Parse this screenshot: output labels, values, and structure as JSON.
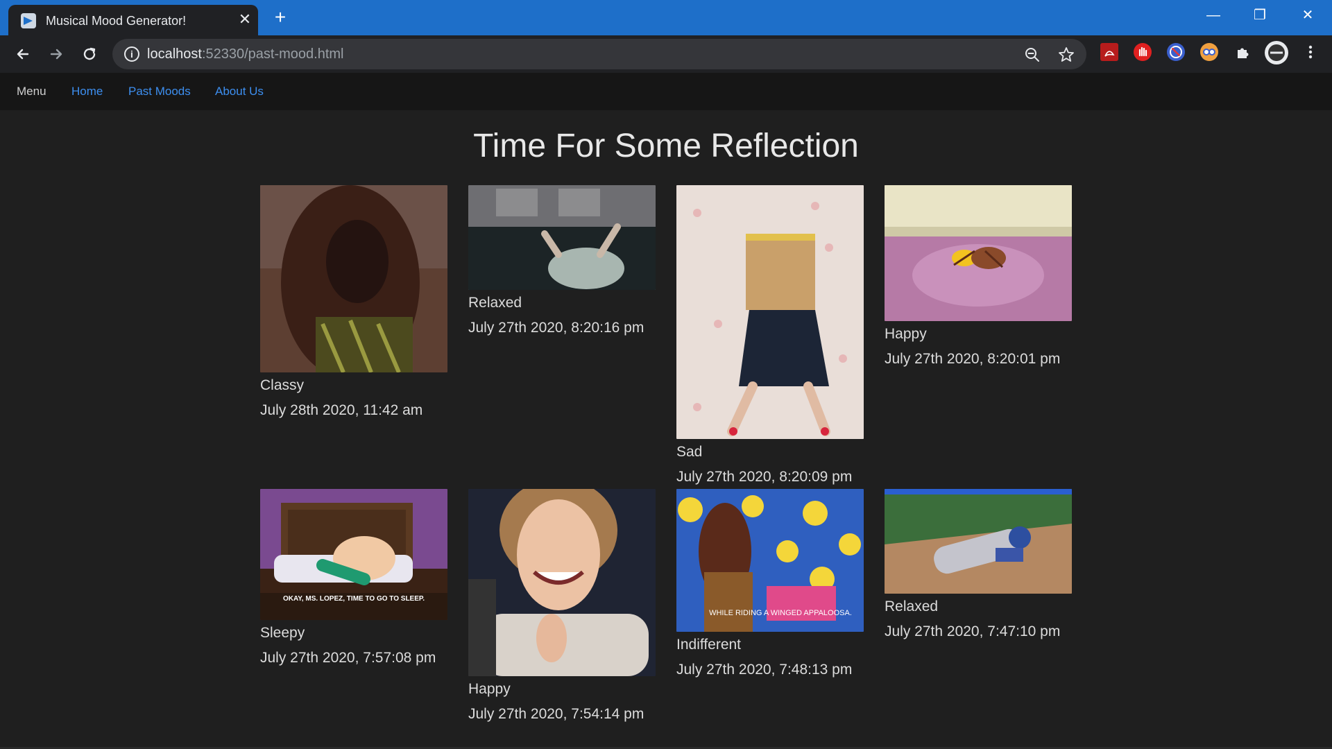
{
  "browser": {
    "tab_title": "Musical Mood Generator!",
    "tab_close": "✕",
    "new_tab": "+",
    "url_host": "localhost",
    "url_rest": ":52330/past-mood.html",
    "window_controls": {
      "minimize": "—",
      "restore": "❐",
      "close": "✕"
    },
    "icons": [
      "back-icon",
      "forward-icon",
      "reload-icon",
      "info-icon",
      "zoom-out-icon",
      "star-icon",
      "pdf-extension-icon",
      "adblock-extension-icon",
      "block-extension-icon",
      "extension-icon",
      "puzzle-extensions-icon",
      "profile-avatar",
      "more-menu-icon"
    ]
  },
  "nav": {
    "brand": "Menu",
    "links": [
      "Home",
      "Past Moods",
      "About Us"
    ]
  },
  "page": {
    "heading": "Time For Some Reflection"
  },
  "moods": [
    {
      "mood": "Classy",
      "time": "July 28th 2020, 11:42 am",
      "colors": [
        "#4a2a20",
        "#2c1710"
      ]
    },
    {
      "mood": "Relaxed",
      "time": "July 27th 2020, 8:20:16 pm",
      "colors": [
        "#5a5a5e",
        "#1b2a2d"
      ]
    },
    {
      "mood": "Sad",
      "time": "July 27th 2020, 8:20:09 pm",
      "colors": [
        "#e8ddd6",
        "#cbb89c"
      ]
    },
    {
      "mood": "Happy",
      "time": "July 27th 2020, 8:20:01 pm",
      "colors": [
        "#c88ab8",
        "#9a5d8c"
      ]
    },
    {
      "mood": "Sleepy",
      "time": "July 27th 2020, 7:57:08 pm",
      "colors": [
        "#6e3f86",
        "#4a2a1c"
      ]
    },
    {
      "mood": "Happy",
      "time": "July 27th 2020, 7:54:14 pm",
      "colors": [
        "#1f2535",
        "#d7cfc6"
      ]
    },
    {
      "mood": "Indifferent",
      "time": "July 27th 2020, 7:48:13 pm",
      "colors": [
        "#3d6fd0",
        "#e2c440"
      ]
    },
    {
      "mood": "Relaxed",
      "time": "July 27th 2020, 7:47:10 pm",
      "colors": [
        "#3e6e3a",
        "#b88a64"
      ]
    }
  ],
  "captions": {
    "sleepy_gif": "OKAY, MS. LOPEZ, TIME TO GO TO SLEEP.",
    "indifferent_gif": "WHILE RIDING A WINGED APPALOOSA."
  }
}
